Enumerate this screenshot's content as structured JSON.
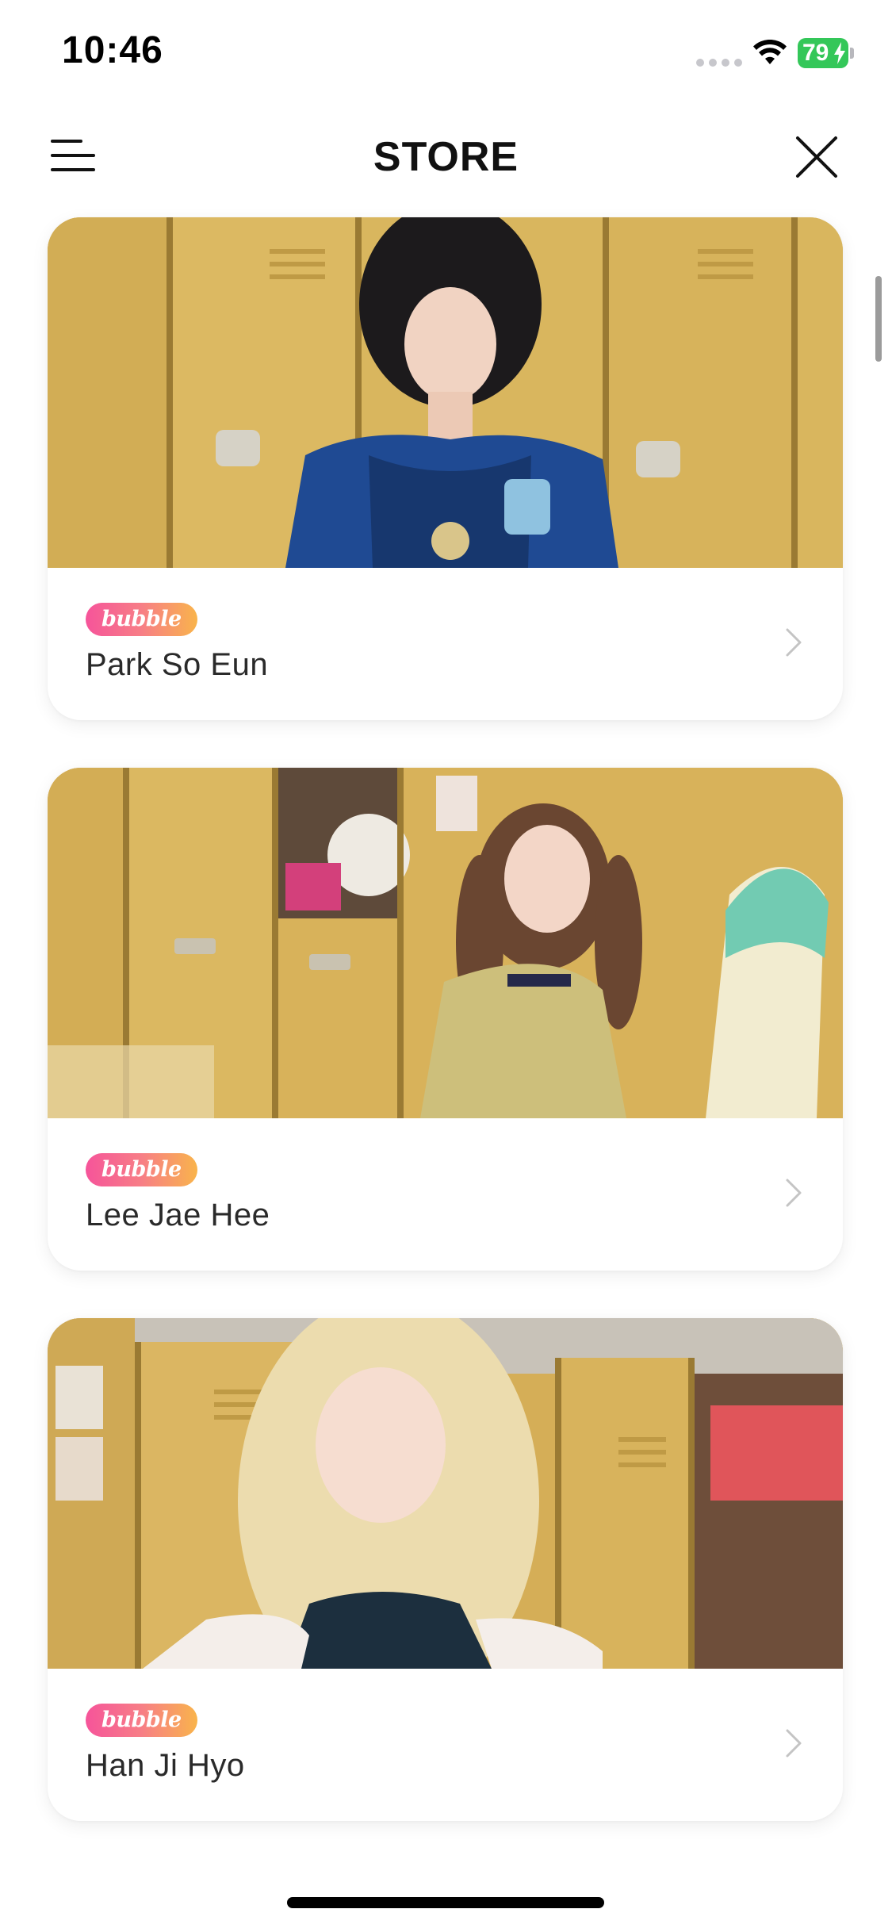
{
  "status_bar": {
    "time": "10:46",
    "battery": "79"
  },
  "header": {
    "title": "STORE",
    "menu_icon": "hamburger-menu-icon",
    "close_icon": "close-icon"
  },
  "cards": [
    {
      "badge": "bubble",
      "name": "Park So Eun",
      "photo": "locker-photo"
    },
    {
      "badge": "bubble",
      "name": "Lee Jae Hee",
      "photo": "locker-photo"
    },
    {
      "badge": "bubble",
      "name": "Han Ji Hyo",
      "photo": "locker-photo"
    }
  ],
  "colors": {
    "battery": "#34c759",
    "badge_gradient": [
      "#f6549a",
      "#f9b44b"
    ],
    "locker": "#d8b660"
  }
}
